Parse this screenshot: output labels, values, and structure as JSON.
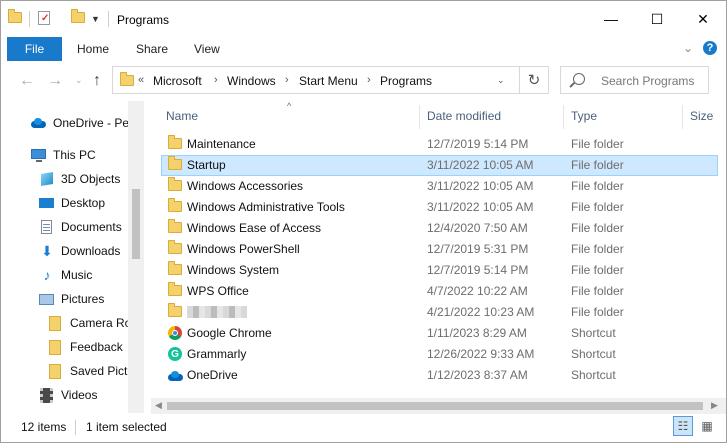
{
  "window": {
    "title": "Programs",
    "controls": {
      "minimize": "—",
      "maximize": "☐",
      "close": "✕"
    }
  },
  "ribbon": {
    "tabs": [
      "File",
      "Home",
      "Share",
      "View"
    ]
  },
  "address": {
    "prefix": "«",
    "crumbs": [
      "Microsoft",
      "Windows",
      "Start Menu",
      "Programs"
    ]
  },
  "search": {
    "placeholder": "Search Programs"
  },
  "nav_pane": {
    "items": [
      {
        "label": "OneDrive - Per",
        "icon": "onedrive-icon"
      },
      {
        "label": "This PC",
        "icon": "pc-icon"
      },
      {
        "label": "3D Objects",
        "icon": "3d-objects-icon"
      },
      {
        "label": "Desktop",
        "icon": "desktop-icon"
      },
      {
        "label": "Documents",
        "icon": "documents-icon"
      },
      {
        "label": "Downloads",
        "icon": "downloads-icon"
      },
      {
        "label": "Music",
        "icon": "music-icon"
      },
      {
        "label": "Pictures",
        "icon": "pictures-icon"
      },
      {
        "label": "Camera Rol",
        "icon": "folder-icon"
      },
      {
        "label": "Feedback",
        "icon": "folder-icon"
      },
      {
        "label": "Saved Pictu",
        "icon": "folder-icon"
      },
      {
        "label": "Videos",
        "icon": "videos-icon"
      }
    ]
  },
  "columns": {
    "name": "Name",
    "date": "Date modified",
    "type": "Type",
    "size": "Size"
  },
  "files": [
    {
      "name": "Maintenance",
      "date": "12/7/2019 5:14 PM",
      "type": "File folder",
      "icon": "folder-icon"
    },
    {
      "name": "Startup",
      "date": "3/11/2022 10:05 AM",
      "type": "File folder",
      "icon": "folder-icon",
      "selected": true
    },
    {
      "name": "Windows Accessories",
      "date": "3/11/2022 10:05 AM",
      "type": "File folder",
      "icon": "folder-icon"
    },
    {
      "name": "Windows Administrative Tools",
      "date": "3/11/2022 10:05 AM",
      "type": "File folder",
      "icon": "folder-icon"
    },
    {
      "name": "Windows Ease of Access",
      "date": "12/4/2020 7:50 AM",
      "type": "File folder",
      "icon": "folder-icon"
    },
    {
      "name": "Windows PowerShell",
      "date": "12/7/2019 5:31 PM",
      "type": "File folder",
      "icon": "folder-icon"
    },
    {
      "name": "Windows System",
      "date": "12/7/2019 5:14 PM",
      "type": "File folder",
      "icon": "folder-icon"
    },
    {
      "name": "WPS Office",
      "date": "4/7/2022 10:22 AM",
      "type": "File folder",
      "icon": "folder-icon"
    },
    {
      "name": "",
      "date": "4/21/2022 10:23 AM",
      "type": "File folder",
      "icon": "folder-icon",
      "blurred": true
    },
    {
      "name": "Google Chrome",
      "date": "1/11/2023 8:29 AM",
      "type": "Shortcut",
      "icon": "chrome-icon"
    },
    {
      "name": "Grammarly",
      "date": "12/26/2022 9:33 AM",
      "type": "Shortcut",
      "icon": "grammarly-icon"
    },
    {
      "name": "OneDrive",
      "date": "1/12/2023 8:37 AM",
      "type": "Shortcut",
      "icon": "onedrive-icon"
    }
  ],
  "status": {
    "count": "12 items",
    "selection": "1 item selected"
  },
  "colors": {
    "accent": "#1979ca",
    "selection": "#cde8ff",
    "header_text": "#4c607a"
  }
}
